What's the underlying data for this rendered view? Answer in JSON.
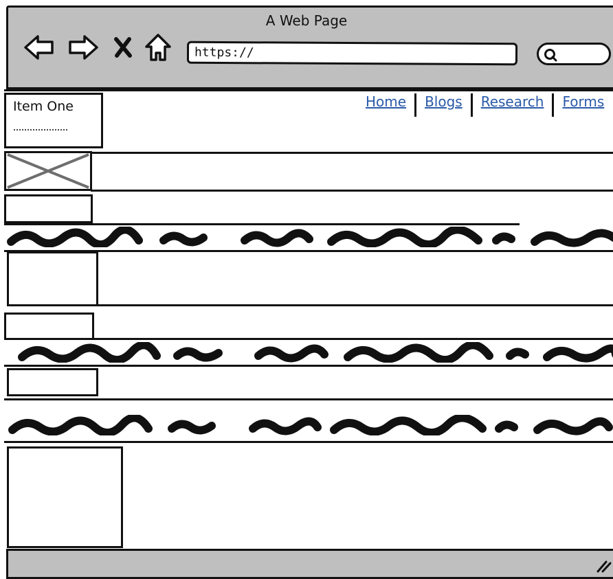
{
  "window": {
    "title": "A Web Page"
  },
  "toolbar": {
    "buttons": [
      {
        "name": "back-button",
        "icon": "arrow-left-icon"
      },
      {
        "name": "forward-button",
        "icon": "arrow-right-icon"
      },
      {
        "name": "stop-button",
        "icon": "close-icon"
      },
      {
        "name": "home-button",
        "icon": "home-icon"
      }
    ],
    "url": "https://",
    "search_icon": "search-icon"
  },
  "sidebar": {
    "item_label": "Item One"
  },
  "nav": {
    "links": [
      "Home",
      "Blogs",
      "Research",
      "Forms"
    ]
  },
  "colors": {
    "chrome": "#bfbfbf",
    "link": "#2a5aa8",
    "stroke": "#111111"
  }
}
